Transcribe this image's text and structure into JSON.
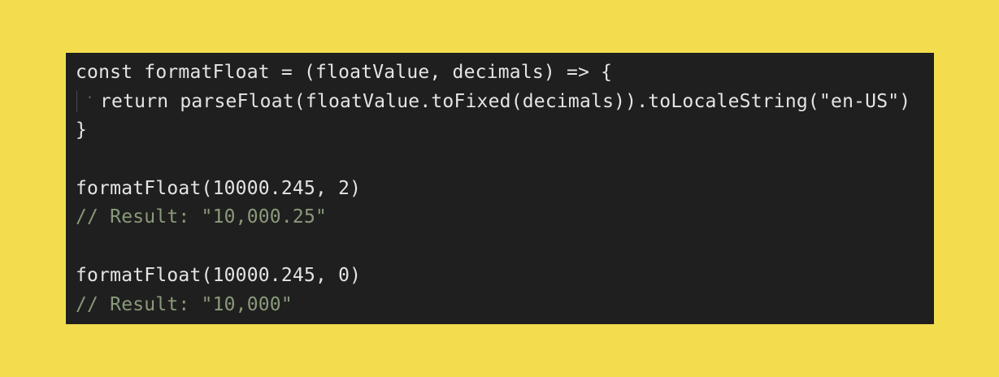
{
  "code": {
    "lines": [
      "const formatFloat = (floatValue, decimals) => {",
      "return parseFloat(floatValue.toFixed(decimals)).toLocaleString(\"en-US\")",
      "}",
      "",
      "formatFloat(10000.245, 2)",
      "// Result: \"10,000.25\"",
      "",
      "formatFloat(10000.245, 0)",
      "// Result: \"10,000\""
    ]
  },
  "colors": {
    "background": "#f3dd4e",
    "editor_bg": "#1f1f1f",
    "code_text": "#e4e4e4",
    "comment_text": "#8a9a7a"
  }
}
